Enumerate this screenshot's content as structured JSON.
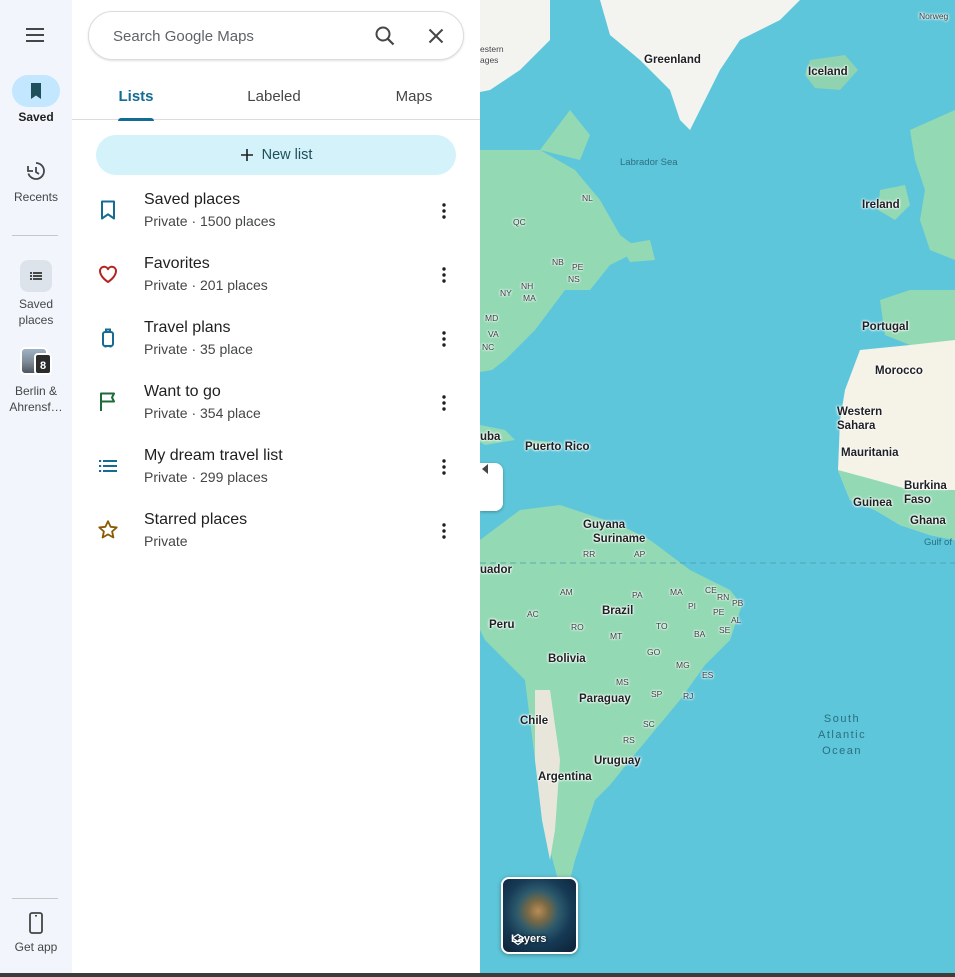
{
  "rail": {
    "menu_icon": "menu-icon",
    "items": [
      {
        "label": "Saved",
        "icon": "bookmark-icon",
        "active": true
      },
      {
        "label": "Recents",
        "icon": "history-icon",
        "active": false
      }
    ],
    "collections": [
      {
        "label": "Saved places",
        "icon": "list-icon"
      },
      {
        "label": "Berlin & Ahrensf…",
        "count": "8"
      }
    ],
    "get_app": {
      "label": "Get app",
      "icon": "phone-icon"
    }
  },
  "search": {
    "placeholder": "Search Google Maps",
    "search_icon": "search-icon",
    "clear_icon": "close-icon"
  },
  "tabs": [
    {
      "label": "Lists",
      "active": true
    },
    {
      "label": "Labeled",
      "active": false
    },
    {
      "label": "Maps",
      "active": false
    }
  ],
  "new_list": {
    "label": "New list",
    "icon": "plus-icon"
  },
  "lists": [
    {
      "title": "Saved places",
      "subtitle": "Private · 1500 places",
      "icon": "bookmark-icon",
      "color": "#146c94"
    },
    {
      "title": "Favorites",
      "subtitle": "Private · 201 places",
      "icon": "heart-icon",
      "color": "#b3261e"
    },
    {
      "title": "Travel plans",
      "subtitle": "Private · 35 place",
      "icon": "suitcase-icon",
      "color": "#146c94"
    },
    {
      "title": "Want to go",
      "subtitle": "Private · 354 place",
      "icon": "flag-icon",
      "color": "#1e6b3a"
    },
    {
      "title": "My dream travel list",
      "subtitle": "Private · 299 places",
      "icon": "list-icon",
      "color": "#146c94"
    },
    {
      "title": "Starred places",
      "subtitle": "Private",
      "icon": "star-icon",
      "color": "#8a5a00"
    }
  ],
  "map": {
    "labels": {
      "greenland": "Greenland",
      "iceland": "Iceland",
      "norway": "Norweg",
      "labrador_sea": "Labrador Sea",
      "ireland": "Ireland",
      "portugal": "Portugal",
      "morocco": "Morocco",
      "western_sahara": "Western\nSahara",
      "mauritania": "Mauritania",
      "burkina": "Burkina\nFaso",
      "guinea": "Guinea",
      "ghana": "Ghana",
      "gulf": "Gulf of",
      "puerto_rico": "Puerto Rico",
      "cuba": "uba",
      "guyana": "Guyana",
      "suriname": "Suriname",
      "ecuador": "uador",
      "peru": "Peru",
      "brazil": "Brazil",
      "bolivia": "Bolivia",
      "paraguay": "Paraguay",
      "chile": "Chile",
      "uruguay": "Uruguay",
      "argentina": "Argentina",
      "south_atlantic": "South\nAtlantic\nOcean",
      "nl": "NL",
      "qc": "QC",
      "nb": "NB",
      "pe": "PE",
      "ns": "NS",
      "ny": "NY",
      "nh": "NH",
      "ma": "MA",
      "md": "MD",
      "va": "VA",
      "nc": "NC",
      "estern": "estern\nages",
      "rr": "RR",
      "ap": "AP",
      "am": "AM",
      "pa": "PA",
      "ma2": "MA",
      "ce": "CE",
      "pi": "PI",
      "rn": "RN",
      "pb": "PB",
      "pe2": "PE",
      "al": "AL",
      "se": "SE",
      "to": "TO",
      "ba": "BA",
      "ac": "AC",
      "ro": "RO",
      "mt": "MT",
      "go": "GO",
      "mg": "MG",
      "es": "ES",
      "ms": "MS",
      "sp": "SP",
      "rj": "RJ",
      "sc": "SC",
      "rs": "RS"
    },
    "collapse_icon": "chevron-left-icon",
    "layers": {
      "label": "Layers",
      "icon": "layers-icon"
    }
  },
  "colors": {
    "water": "#5ec6da",
    "land": "#93d9b4",
    "ice": "#f4f4f2",
    "accent": "#146c94"
  }
}
